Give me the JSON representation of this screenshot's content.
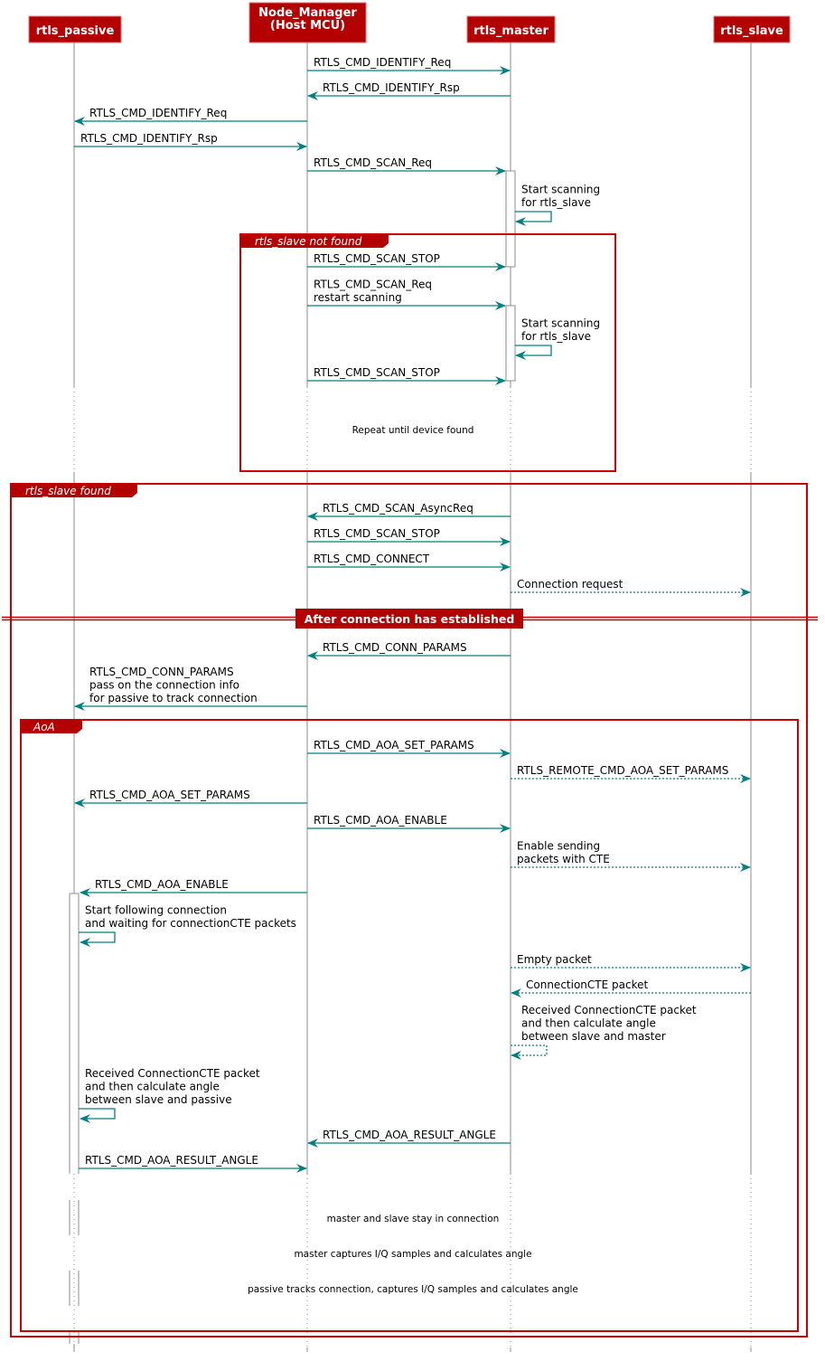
{
  "colors": {
    "participant_fill": "#B30000",
    "frame_border": "#CC0000",
    "arrow": "#008080",
    "lifeline": "#8C8C8C",
    "text": "#000000"
  },
  "participants": [
    {
      "id": "passive",
      "label": [
        "rtls_passive"
      ]
    },
    {
      "id": "nm",
      "label": [
        "Node_Manager",
        "(Host MCU)"
      ]
    },
    {
      "id": "master",
      "label": [
        "rtls_master"
      ]
    },
    {
      "id": "slave",
      "label": [
        "rtls_slave"
      ]
    }
  ],
  "messages": [
    {
      "from": "nm",
      "to": "master",
      "lines": [
        "RTLS_CMD_IDENTIFY_Req"
      ],
      "style": "solid"
    },
    {
      "from": "master",
      "to": "nm",
      "lines": [
        "RTLS_CMD_IDENTIFY_Rsp"
      ],
      "style": "solid"
    },
    {
      "from": "nm",
      "to": "passive",
      "lines": [
        "RTLS_CMD_IDENTIFY_Req"
      ],
      "style": "solid"
    },
    {
      "from": "passive",
      "to": "nm",
      "lines": [
        "RTLS_CMD_IDENTIFY_Rsp"
      ],
      "style": "solid"
    },
    {
      "from": "nm",
      "to": "master",
      "lines": [
        "RTLS_CMD_SCAN_Req"
      ],
      "style": "solid"
    },
    {
      "from": "master",
      "to": "master",
      "lines": [
        "Start scanning",
        "for rtls_slave"
      ],
      "style": "solid"
    },
    {
      "from": "nm",
      "to": "master",
      "lines": [
        "RTLS_CMD_SCAN_STOP"
      ],
      "style": "solid"
    },
    {
      "from": "nm",
      "to": "master",
      "lines": [
        "RTLS_CMD_SCAN_Req",
        "restart scanning"
      ],
      "style": "solid"
    },
    {
      "from": "master",
      "to": "master",
      "lines": [
        "Start scanning",
        "for rtls_slave"
      ],
      "style": "solid"
    },
    {
      "from": "nm",
      "to": "master",
      "lines": [
        "RTLS_CMD_SCAN_STOP"
      ],
      "style": "solid"
    },
    {
      "from": "master",
      "to": "nm",
      "lines": [
        "RTLS_CMD_SCAN_AsyncReq"
      ],
      "style": "solid"
    },
    {
      "from": "nm",
      "to": "master",
      "lines": [
        "RTLS_CMD_SCAN_STOP"
      ],
      "style": "solid"
    },
    {
      "from": "nm",
      "to": "master",
      "lines": [
        "RTLS_CMD_CONNECT"
      ],
      "style": "solid"
    },
    {
      "from": "master",
      "to": "slave",
      "lines": [
        "Connection request"
      ],
      "style": "dotted"
    },
    {
      "from": "master",
      "to": "nm",
      "lines": [
        "RTLS_CMD_CONN_PARAMS"
      ],
      "style": "solid"
    },
    {
      "from": "nm",
      "to": "passive",
      "lines": [
        "RTLS_CMD_CONN_PARAMS",
        "pass on the connection info",
        "for passive to track connection"
      ],
      "style": "solid"
    },
    {
      "from": "nm",
      "to": "master",
      "lines": [
        "RTLS_CMD_AOA_SET_PARAMS"
      ],
      "style": "solid"
    },
    {
      "from": "master",
      "to": "slave",
      "lines": [
        "RTLS_REMOTE_CMD_AOA_SET_PARAMS"
      ],
      "style": "dotted"
    },
    {
      "from": "nm",
      "to": "passive",
      "lines": [
        "RTLS_CMD_AOA_SET_PARAMS"
      ],
      "style": "solid"
    },
    {
      "from": "nm",
      "to": "master",
      "lines": [
        "RTLS_CMD_AOA_ENABLE"
      ],
      "style": "solid"
    },
    {
      "from": "master",
      "to": "slave",
      "lines": [
        "Enable sending",
        "packets with CTE"
      ],
      "style": "dotted"
    },
    {
      "from": "nm",
      "to": "passive",
      "lines": [
        "RTLS_CMD_AOA_ENABLE"
      ],
      "style": "solid"
    },
    {
      "from": "passive",
      "to": "passive",
      "lines": [
        "Start following connection",
        "and waiting for connectionCTE packets"
      ],
      "style": "solid"
    },
    {
      "from": "master",
      "to": "slave",
      "lines": [
        "Empty packet"
      ],
      "style": "dotted"
    },
    {
      "from": "slave",
      "to": "master",
      "lines": [
        "ConnectionCTE packet"
      ],
      "style": "dotted"
    },
    {
      "from": "master",
      "to": "master",
      "lines": [
        "Received ConnectionCTE packet",
        "and then calculate angle",
        "between slave and master"
      ],
      "style": "dotted"
    },
    {
      "from": "passive",
      "to": "passive",
      "lines": [
        "Received ConnectionCTE packet",
        "and then calculate angle",
        "between slave and passive"
      ],
      "style": "solid"
    },
    {
      "from": "master",
      "to": "nm",
      "lines": [
        "RTLS_CMD_AOA_RESULT_ANGLE"
      ],
      "style": "solid"
    },
    {
      "from": "passive",
      "to": "nm",
      "lines": [
        "RTLS_CMD_AOA_RESULT_ANGLE"
      ],
      "style": "solid"
    }
  ],
  "frames": [
    {
      "id": "not-found",
      "title": "rtls_slave not found"
    },
    {
      "id": "found",
      "title": "rtls_slave found"
    },
    {
      "id": "aoa",
      "title": "AoA"
    }
  ],
  "divider": {
    "label": "After connection has established"
  },
  "delays": [
    {
      "label": "Repeat until device found"
    },
    {
      "label": "master and slave stay in connection"
    },
    {
      "label": "master captures I/Q samples and calculates angle"
    },
    {
      "label": "passive tracks connection, captures I/Q samples and calculates angle"
    }
  ]
}
